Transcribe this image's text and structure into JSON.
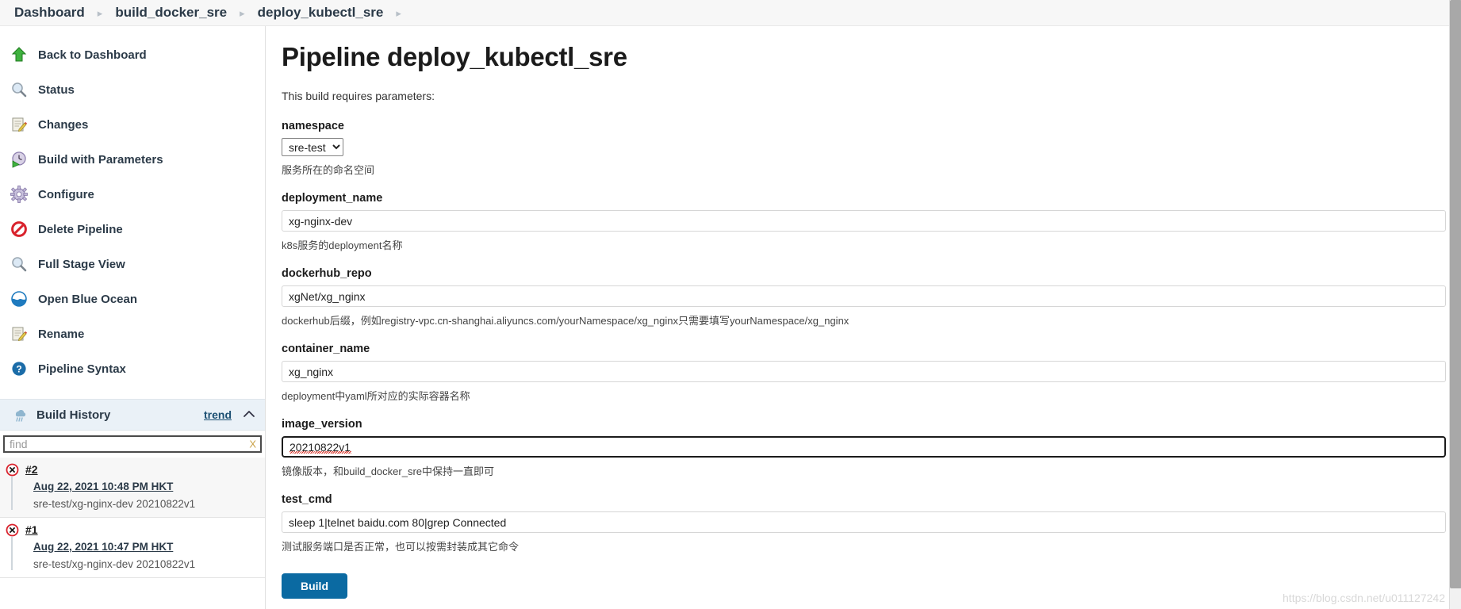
{
  "breadcrumb": {
    "items": [
      {
        "label": "Dashboard",
        "name": "breadcrumb-dashboard"
      },
      {
        "label": "build_docker_sre",
        "name": "breadcrumb-build-docker-sre"
      },
      {
        "label": "deploy_kubectl_sre",
        "name": "breadcrumb-deploy-kubectl-sre"
      }
    ],
    "separator": "▸"
  },
  "sidebar": {
    "tasks": [
      {
        "label": "Back to Dashboard",
        "icon": "up-arrow-icon"
      },
      {
        "label": "Status",
        "icon": "magnifier-icon"
      },
      {
        "label": "Changes",
        "icon": "notepad-pencil-icon"
      },
      {
        "label": "Build with Parameters",
        "icon": "play-clock-icon"
      },
      {
        "label": "Configure",
        "icon": "gear-icon"
      },
      {
        "label": "Delete Pipeline",
        "icon": "no-entry-icon"
      },
      {
        "label": "Full Stage View",
        "icon": "magnifier-icon"
      },
      {
        "label": "Open Blue Ocean",
        "icon": "blue-ocean-icon"
      },
      {
        "label": "Rename",
        "icon": "notepad-pencil-icon"
      },
      {
        "label": "Pipeline Syntax",
        "icon": "help-question-icon"
      }
    ],
    "build_history": {
      "title": "Build History",
      "icon": "weather-trend-icon",
      "trend_label": "trend",
      "collapse_icon": "chevron-up-icon",
      "find": {
        "value": "",
        "placeholder": "find",
        "clear_label": "X"
      },
      "builds": [
        {
          "number": "#2",
          "status": "failed",
          "date": "Aug 22, 2021 10:48 PM HKT",
          "description": "sre-test/xg-nginx-dev 20210822v1"
        },
        {
          "number": "#1",
          "status": "failed",
          "date": "Aug 22, 2021 10:47 PM HKT",
          "description": "sre-test/xg-nginx-dev 20210822v1"
        }
      ]
    }
  },
  "main": {
    "title": "Pipeline deploy_kubectl_sre",
    "requires_text": "This build requires parameters:",
    "parameters": [
      {
        "name": "namespace",
        "type": "select",
        "value": "sre-test",
        "options": [
          "sre-test"
        ],
        "description": "服务所在的命名空间",
        "focused": false
      },
      {
        "name": "deployment_name",
        "type": "text",
        "value": "xg-nginx-dev",
        "description": "k8s服务的deployment名称",
        "focused": false
      },
      {
        "name": "dockerhub_repo",
        "type": "text",
        "value": "xgNet/xg_nginx",
        "description": "dockerhub后缀，例如registry-vpc.cn-shanghai.aliyuncs.com/yourNamespace/xg_nginx只需要填写yourNamespace/xg_nginx",
        "focused": false
      },
      {
        "name": "container_name",
        "type": "text",
        "value": "xg_nginx",
        "description": "deployment中yaml所对应的实际容器名称",
        "focused": false
      },
      {
        "name": "image_version",
        "type": "text",
        "value": "20210822v1",
        "description": "镜像版本，和build_docker_sre中保持一直即可",
        "focused": true
      },
      {
        "name": "test_cmd",
        "type": "text",
        "value": "sleep 1|telnet baidu.com 80|grep Connected",
        "description": "测试服务端口是否正常，也可以按需封装成其它命令",
        "focused": false
      }
    ],
    "build_button_label": "Build"
  },
  "watermark": "https://blog.csdn.net/u011127242",
  "colors": {
    "accent_blue": "#0b6aa2",
    "breadcrumb_bg": "#f7f7f7",
    "build_history_bg": "#eaf1f7",
    "failed_red": "#d9232d",
    "link_blue": "#1b4f72"
  }
}
